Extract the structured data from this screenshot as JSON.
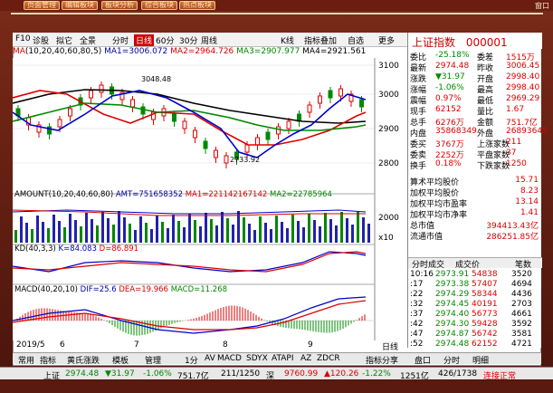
{
  "topbar": {
    "buttons": [
      "页面管理",
      "编辑板块",
      "板块分析",
      "综合板块",
      "热点板块"
    ],
    "window_controls": "窗口"
  },
  "toolbar": {
    "f10": "F10",
    "plate": "诊股",
    "ruler": "拟它",
    "all": "全景",
    "timeshare": "分时",
    "day": "日线",
    "m60": "60分",
    "m30": "30分",
    "period": "周线",
    "kline": "K线",
    "indicator": "指标叠加",
    "fav": "自选",
    "more": "更多"
  },
  "mabar": {
    "label": "MA",
    "params": "(10,20,40,60,80,5)",
    "ma1": "MA1=3006.072",
    "ma2": "MA2=2964.726",
    "ma3": "MA3=2907.977",
    "ma4": "MA4=2921.561"
  },
  "price_axis": [
    "3100",
    "3000",
    "2900",
    "2800"
  ],
  "annotations": {
    "high": "3048.48",
    "low": "2733.92"
  },
  "amount_bar": {
    "label": "AMOUNT",
    "params": "(10,20,40,60,80)",
    "amt": "AMT=751658352",
    "ma1": "MA1=221142167142",
    "ma2": "MA2=22785964"
  },
  "amount_axis": [
    "2000",
    "x10"
  ],
  "kd_bar": {
    "label": "KD",
    "params": "(40,3,3)",
    "k": "K=84.083",
    "d": "D=86.891"
  },
  "macd_bar": {
    "label": "MACD",
    "params": "(40,20,10)",
    "dif": "DIF=25.6",
    "dea": "DEA=19.966",
    "macd": "MACD=11.268"
  },
  "dates": [
    "2019/5",
    "6",
    "7",
    "8",
    "9",
    "日线"
  ],
  "right": {
    "name": "上证指数",
    "code": "000001",
    "rows": [
      {
        "l1": "委比",
        "v1": "-25.18%",
        "l2": "委差",
        "v2": "1515万"
      },
      {
        "l1": "最新",
        "v1": "2974.48",
        "l2": "昨收",
        "v2": "3006.45"
      },
      {
        "l1": "涨跌",
        "v1": "▼31.97",
        "l2": "开盘",
        "v2": "2998.40"
      },
      {
        "l1": "涨幅",
        "v1": "-1.06%",
        "l2": "最高",
        "v2": "2998.40"
      },
      {
        "l1": "震幅",
        "v1": "0.97%",
        "l2": "最低",
        "v2": "2969.29"
      },
      {
        "l1": "现手",
        "v1": "62152",
        "l2": "量比",
        "v2": "1.67"
      },
      {
        "l1": "总手",
        "v1": "6276万",
        "l2": "金额",
        "v2": "751.7亿"
      },
      {
        "l1": "内盘",
        "v1": "35868349",
        "l2": "外盘",
        "v2": "26893645"
      },
      {
        "l1": "委买",
        "v1": "3767万",
        "l2": "上涨家数",
        "v2": "211"
      },
      {
        "l1": "委卖",
        "v1": "2252万",
        "l2": "平盘家数",
        "v2": "37"
      },
      {
        "l1": "换手",
        "v1": "0.18%",
        "l2": "下跌家数",
        "v2": "1250"
      }
    ],
    "stats": [
      {
        "label": "算术平均股价",
        "value": "15.71"
      },
      {
        "label": "加权平均股价",
        "value": "8.23"
      },
      {
        "label": "加权平均市盈率",
        "value": "13.14"
      },
      {
        "label": "加权平均市净率",
        "value": "1.41"
      },
      {
        "label": "总市值",
        "value": "394413.43亿"
      },
      {
        "label": "流通市值",
        "value": "286251.85亿"
      }
    ],
    "trade_header": {
      "title": "分时成交",
      "c1": "成交价",
      "c2": "笔数"
    },
    "trades": [
      {
        "t": "10:16",
        "p": "2973.91",
        "v": "54838",
        "n": "3520"
      },
      {
        "t": ":17",
        "p": "2973.38",
        "v": "57407",
        "n": "4694"
      },
      {
        "t": ":22",
        "p": "2974.29",
        "v": "58344",
        "n": "4436"
      },
      {
        "t": ":32",
        "p": "2974.45",
        "v": "40191",
        "n": "2703"
      },
      {
        "t": ":37",
        "p": "2974.40",
        "v": "56773",
        "n": "4661"
      },
      {
        "t": ":42",
        "p": "2974.30",
        "v": "59428",
        "n": "3592"
      },
      {
        "t": ":47",
        "p": "2974.87",
        "v": "56742",
        "n": "3581"
      },
      {
        "t": ":52",
        "p": "2974.48",
        "v": "62152",
        "n": "4721"
      }
    ]
  },
  "bottomtabs": [
    "常用",
    "指标",
    "黄氏涨跌",
    "模板",
    "管理",
    "1分",
    "AV",
    "MACD",
    "SDYX",
    "ATAPI",
    "AZ",
    "ZDCR",
    "指标分享"
  ],
  "right_tabs": [
    "盘口",
    "分时",
    "明细"
  ],
  "status": {
    "label": "上证",
    "price": "2974.48",
    "change": "▼31.97",
    "pct": "-1.06%",
    "amount": "751.7亿",
    "ratio": "211/1250",
    "sz": "深",
    "sz_price": "9760.99",
    "sz_change": "▲120.26",
    "sz_pct": "-1.22%",
    "sz_amount": "1251亿",
    "sz_ratio": "426/1738",
    "conn": "连接正常"
  }
}
